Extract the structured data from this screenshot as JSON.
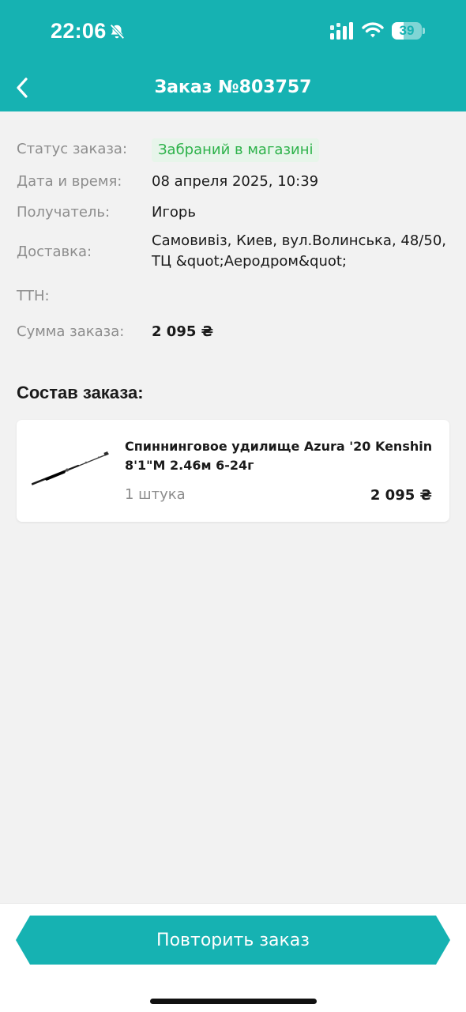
{
  "status_bar": {
    "time": "22:06",
    "battery_level": "39",
    "battery_fraction": 0.39,
    "icons": [
      "bell-slash-icon",
      "signal-icon",
      "wifi-icon",
      "battery-icon"
    ]
  },
  "header": {
    "title": "Заказ №803757",
    "back_icon": "chevron-left-icon",
    "background_color": "#16b2b2"
  },
  "order_info": {
    "status_label": "Статус заказа:",
    "status_value": "Забраний в магазині",
    "status_color": "#2db24a",
    "date_label": "Дата и время:",
    "date_value": "08 апреля 2025, 10:39",
    "recipient_label": "Получатель:",
    "recipient_value": "Игорь",
    "delivery_label": "Доставка:",
    "delivery_value": "Самовивіз, Киев, вул.Волинська, 48/50, ТЦ &quot;Аеродром&quot;",
    "ttn_label": "ТТН:",
    "ttn_value": "",
    "sum_label": "Сумма заказа:",
    "sum_value": "2 095 ₴"
  },
  "order_items": {
    "title": "Состав заказа:",
    "items": [
      {
        "name": "Спиннинговое удилище Azura '20 Kenshin 8'1\"M 2.46м 6-24г",
        "quantity": "1 штука",
        "price": "2 095 ₴",
        "image_icon": "fishing-rod-icon"
      }
    ]
  },
  "footer": {
    "repeat_label": "Повторить заказ"
  }
}
